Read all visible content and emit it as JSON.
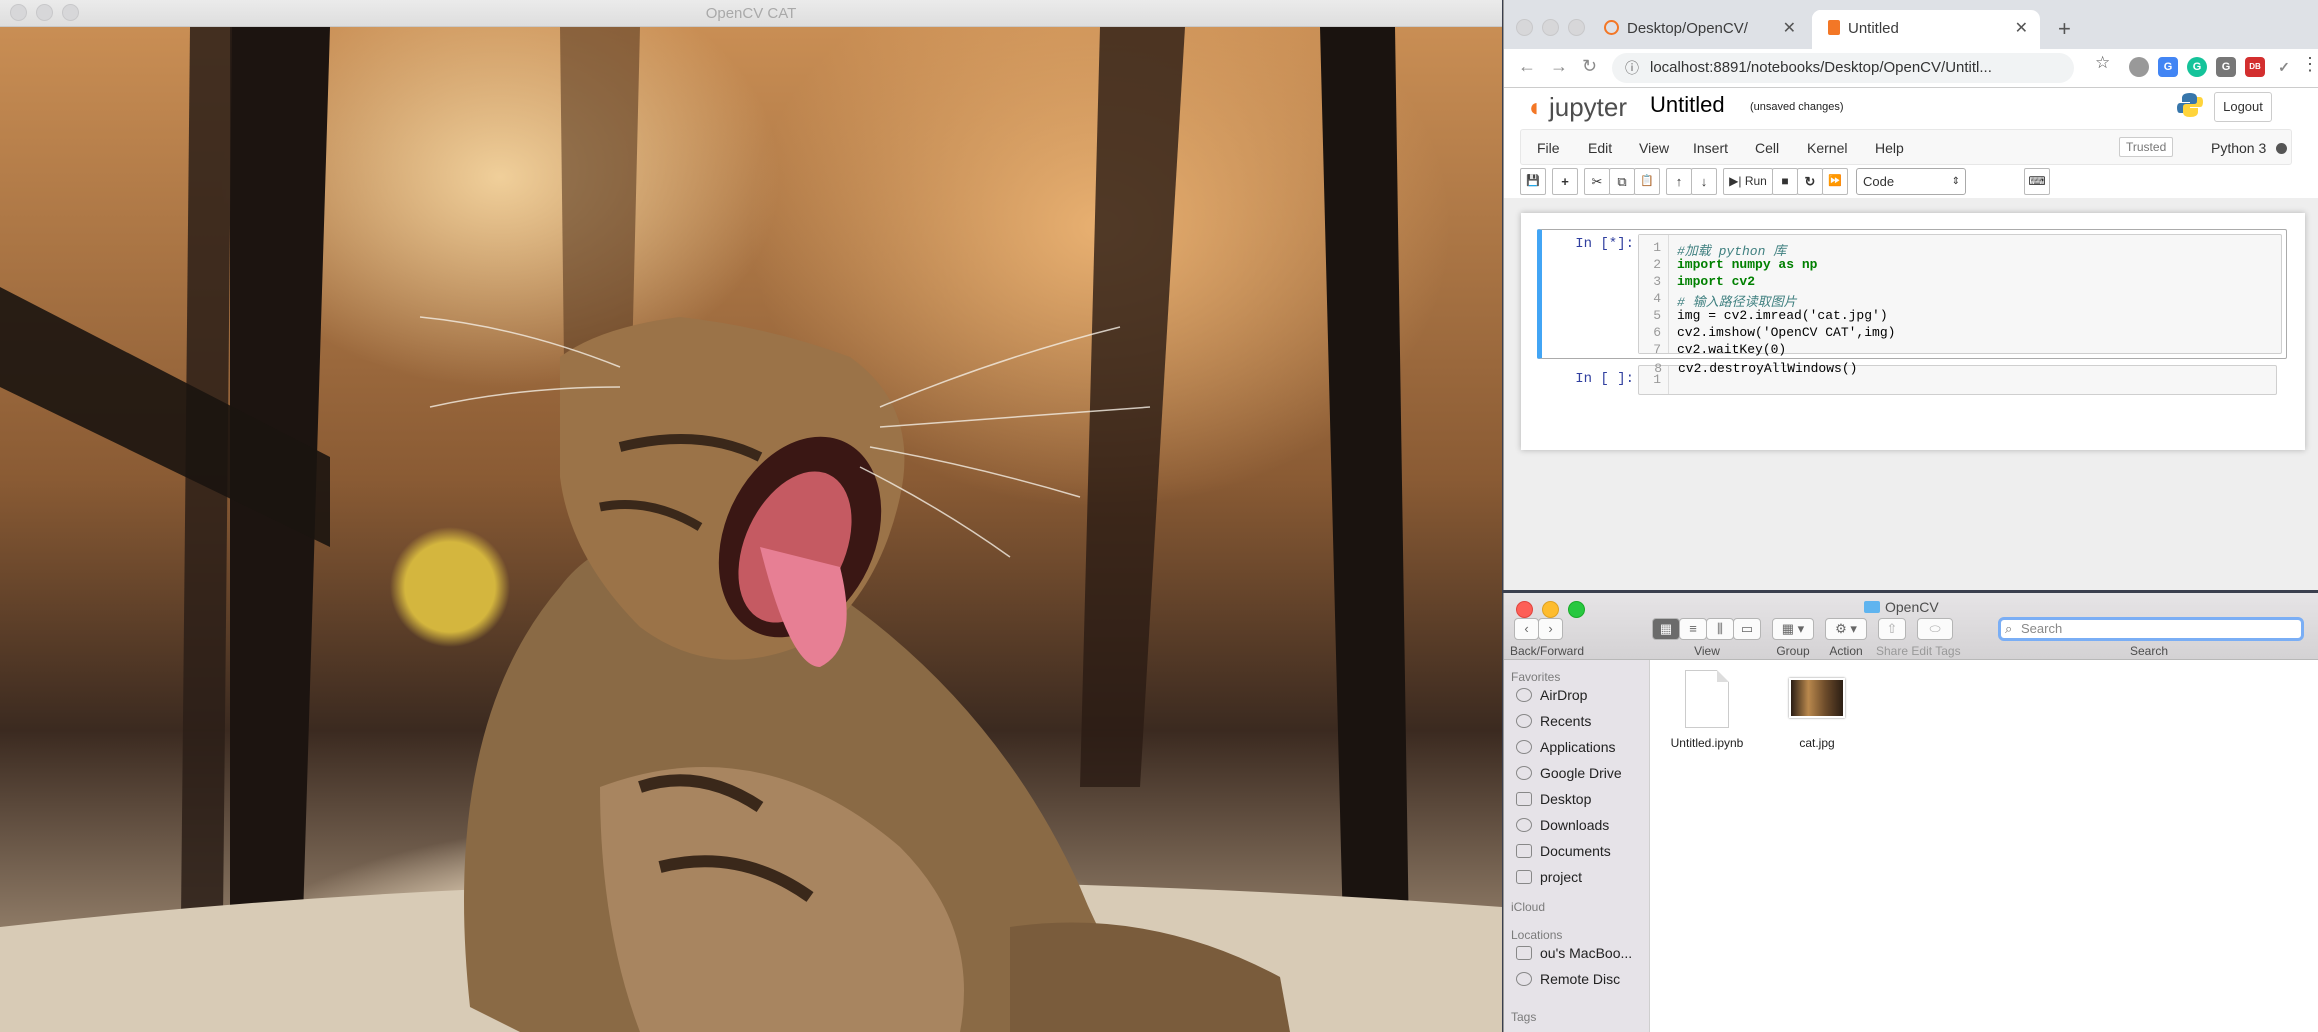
{
  "opencv_window": {
    "title": "OpenCV CAT",
    "image_alt": "cat.jpg"
  },
  "chrome": {
    "tabs": [
      {
        "label": "Desktop/OpenCV/",
        "close": "✕"
      },
      {
        "label": "Untitled",
        "close": "✕"
      }
    ],
    "new_tab": "+",
    "back": "←",
    "forward": "→",
    "reload": "↻",
    "url": "localhost:8891/notebooks/Desktop/OpenCV/Untitl...",
    "bookmark_icon": "☆",
    "extensions": [
      "G",
      "G",
      "DB",
      "✓"
    ],
    "menu": "⋮"
  },
  "jupyter": {
    "logo_text": "jupyter",
    "notebook_title": "Untitled",
    "save_status": "(unsaved changes)",
    "logout": "Logout",
    "menu": [
      "File",
      "Edit",
      "View",
      "Insert",
      "Cell",
      "Kernel",
      "Help"
    ],
    "trusted": "Trusted",
    "kernel_name": "Python 3",
    "toolbar": {
      "save": "💾",
      "add": "+",
      "cut": "✂",
      "copy": "⧉",
      "paste": "📋",
      "up": "↑",
      "down": "↓",
      "run": "▶| Run",
      "stop": "■",
      "restart": "↻",
      "fastforward": "⏩",
      "keyboard": "⌨"
    },
    "cell_type": "Code",
    "cells": [
      {
        "prompt": "In [*]:",
        "lines": [
          {
            "n": "1",
            "text": "#加载 python 库"
          },
          {
            "n": "2",
            "text": "import numpy as np"
          },
          {
            "n": "3",
            "text": "import cv2"
          },
          {
            "n": "4",
            "text": "# 输入路径读取图片"
          },
          {
            "n": "5",
            "text": "img = cv2.imread('cat.jpg')"
          },
          {
            "n": "6",
            "text": "cv2.imshow('OpenCV CAT',img)"
          },
          {
            "n": "7",
            "text": "cv2.waitKey(0)"
          },
          {
            "n": "8",
            "text": "cv2.destroyAllWindows()"
          }
        ]
      },
      {
        "prompt": "In [ ]:",
        "lines": [
          {
            "n": "1",
            "text": ""
          }
        ]
      }
    ]
  },
  "finder": {
    "title": "OpenCV",
    "back_forward_label": "Back/Forward",
    "view_label": "View",
    "group_label": "Group",
    "action_label": "Action",
    "share_label": "Share",
    "edit_tags_label": "Edit Tags",
    "search_placeholder": "Search",
    "search_label": "Search",
    "sidebar": {
      "favorites_header": "Favorites",
      "favorites": [
        "AirDrop",
        "Recents",
        "Applications",
        "Google Drive",
        "Desktop",
        "Downloads",
        "Documents",
        "project"
      ],
      "icloud_header": "iCloud",
      "locations_header": "Locations",
      "locations": [
        "ou's MacBoo...",
        "Remote Disc"
      ],
      "tags_header": "Tags"
    },
    "files": [
      "Untitled.ipynb",
      "cat.jpg"
    ]
  }
}
